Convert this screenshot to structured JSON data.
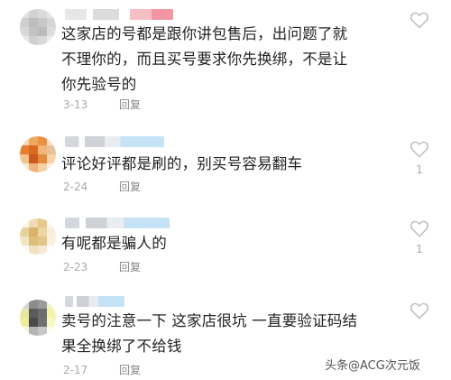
{
  "comments": [
    {
      "text": "这家店的号都是跟你讲包售后，出问题了就不理你的，而且买号要求你先换绑，不是让你先验号的",
      "date": "3-13",
      "reply": "回复",
      "likes": ""
    },
    {
      "text": "评论好评都是刷的，别买号容易翻车",
      "date": "2-24",
      "reply": "回复",
      "likes": "1"
    },
    {
      "text": "有呢都是骗人的",
      "date": "2-23",
      "reply": "回复",
      "likes": "1"
    },
    {
      "text": "卖号的注意一下 这家店很坑 一直要验证码结果全换绑了不给钱",
      "date": "2-17",
      "reply": "回复",
      "likes": ""
    }
  ],
  "watermark": "头条@ACG次元饭",
  "icons": {
    "like": "heart-outline-icon"
  },
  "colors": {
    "text": "#222222",
    "meta": "#aaaaaa",
    "heart": "#bbbbbb"
  }
}
